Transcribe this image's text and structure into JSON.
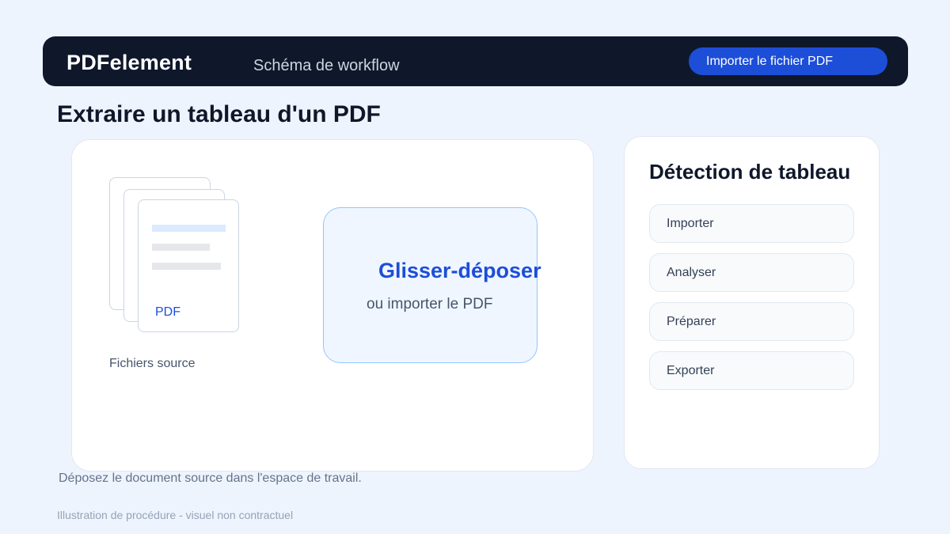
{
  "header": {
    "brand": "PDFelement",
    "subtitle": "Schéma de workflow",
    "import_button": "Importer le fichier PDF"
  },
  "page_title": "Extraire un tableau d'un PDF",
  "workspace": {
    "document_badge": "PDF",
    "files_caption": "Fichiers source",
    "dropzone_title": "Glisser-déposer",
    "dropzone_subtitle": "ou importer le PDF"
  },
  "instruction": "Déposez le document source dans l'espace de travail.",
  "side_panel": {
    "title": "Détection de tableau",
    "steps": [
      {
        "label": "Importer"
      },
      {
        "label": "Analyser"
      },
      {
        "label": "Préparer"
      },
      {
        "label": "Exporter"
      }
    ]
  },
  "footer_note": "Illustration de procédure - visuel non contractuel",
  "colors": {
    "background": "#eef4fd",
    "header_bg": "#0e182a",
    "accent": "#1d4ed8",
    "dropzone_bg": "#eff6ff",
    "dropzone_border": "#93c5fd"
  }
}
